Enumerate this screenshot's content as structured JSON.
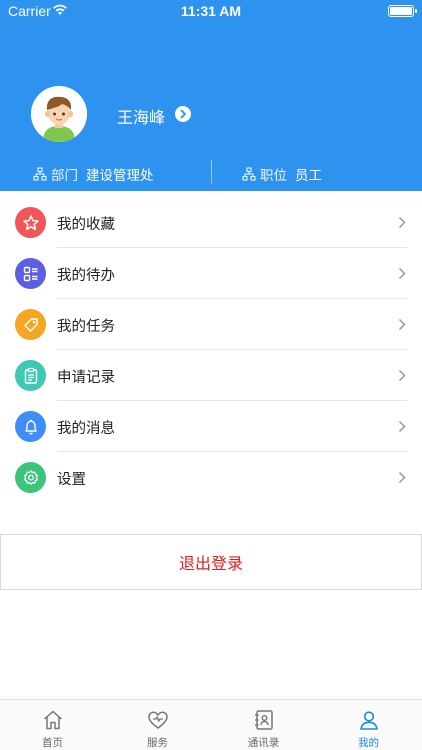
{
  "status_bar": {
    "carrier": "Carrier",
    "time": "11:31 AM"
  },
  "profile": {
    "name": "王海峰",
    "dept_label": "部门",
    "dept_value": "建设管理处",
    "position_label": "职位",
    "position_value": "员工"
  },
  "menu": [
    {
      "label": "我的收藏",
      "icon": "star-icon",
      "color": "#f0565a"
    },
    {
      "label": "我的待办",
      "icon": "todo-list-icon",
      "color": "#5b5fe0"
    },
    {
      "label": "我的任务",
      "icon": "tag-icon",
      "color": "#f5a623"
    },
    {
      "label": "申请记录",
      "icon": "clipboard-icon",
      "color": "#3ec9b3"
    },
    {
      "label": "我的消息",
      "icon": "bell-icon",
      "color": "#3f8ef5"
    },
    {
      "label": "设置",
      "icon": "gear-icon",
      "color": "#3cc47c"
    }
  ],
  "logout_label": "退出登录",
  "tabs": [
    {
      "label": "首页",
      "icon": "home-icon"
    },
    {
      "label": "服务",
      "icon": "heart-icon"
    },
    {
      "label": "通讯录",
      "icon": "contacts-icon"
    },
    {
      "label": "我的",
      "icon": "user-icon",
      "active": true
    }
  ],
  "colors": {
    "header": "#2e93ef",
    "accent": "#1e86e8",
    "logout": "#e02020"
  }
}
